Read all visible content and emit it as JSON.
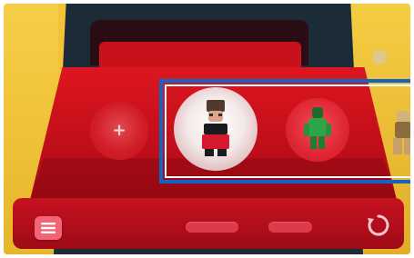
{
  "app": {
    "title": ""
  },
  "carousel": {
    "items": [
      {
        "icon": "plus-icon",
        "selected": false
      },
      {
        "icon": "character-avatar-icon",
        "selected": true
      },
      {
        "icon": "green-character-icon",
        "selected": false
      },
      {
        "icon": "partial-character-icon",
        "selected": false
      }
    ]
  },
  "toolbar": {
    "menu_icon": "menu-icon",
    "refresh_icon": "refresh-icon",
    "pills": [
      "",
      ""
    ]
  },
  "colors": {
    "background": "#f2c338",
    "case_red": "#c10f19",
    "selection_blue": "#1464c8",
    "selection_white": "#ffffff",
    "menu_button": "#f26476"
  }
}
